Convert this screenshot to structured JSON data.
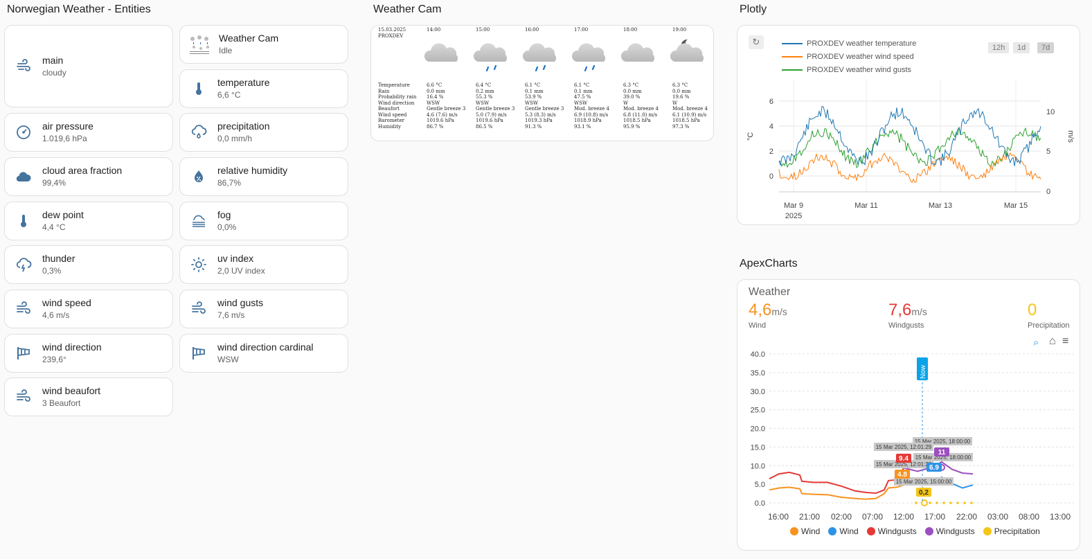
{
  "sections": {
    "entities_title": "Norwegian Weather - Entities",
    "weathercam_title": "Weather Cam",
    "plotly_title": "Plotly",
    "apex_title": "ApexCharts"
  },
  "entities_left": [
    {
      "name": "main",
      "state": "cloudy",
      "icon": "weather-cloudy-icon"
    },
    {
      "name": "air pressure",
      "state": "1.019,6 hPa",
      "icon": "gauge-icon"
    },
    {
      "name": "cloud area fraction",
      "state": "99,4%",
      "icon": "cloud-icon"
    },
    {
      "name": "dew point",
      "state": "4,4 °C",
      "icon": "thermometer-icon"
    },
    {
      "name": "thunder",
      "state": "0,3%",
      "icon": "lightning-cloud-icon"
    },
    {
      "name": "wind speed",
      "state": "4,6 m/s",
      "icon": "wind-icon"
    },
    {
      "name": "wind direction",
      "state": "239,6°",
      "icon": "windsock-icon"
    },
    {
      "name": "wind beaufort",
      "state": "3 Beaufort",
      "icon": "wind-icon"
    }
  ],
  "entities_right": [
    {
      "name": "Weather Cam",
      "state": "Idle",
      "icon": "weather-cam-thumbnail"
    },
    {
      "name": "temperature",
      "state": "6,6 °C",
      "icon": "thermometer-icon"
    },
    {
      "name": "precipitation",
      "state": "0,0 mm/h",
      "icon": "rain-cloud-icon"
    },
    {
      "name": "relative humidity",
      "state": "86,7%",
      "icon": "water-percent-icon"
    },
    {
      "name": "fog",
      "state": "0,0%",
      "icon": "fog-icon"
    },
    {
      "name": "uv index",
      "state": "2,0 UV index",
      "icon": "sun-icon"
    },
    {
      "name": "wind gusts",
      "state": "7,6 m/s",
      "icon": "wind-icon"
    },
    {
      "name": "wind direction cardinal",
      "state": "WSW",
      "icon": "windsock-icon"
    }
  ],
  "weathercam": {
    "date": "15.03.2025",
    "station": "PROXDEV",
    "row_labels": [
      "Temperature",
      "Rain",
      "Probability rain",
      "Wind direction",
      "Beaufort",
      "Wind speed",
      "Barometer",
      "Humidity"
    ],
    "columns": [
      {
        "time": "14:00",
        "rain": false,
        "night": false,
        "values": [
          "6.6 °C",
          "0.0 mm",
          "16.4 %",
          "WSW",
          "Gentle breeze 3",
          "4.6 (7.6) m/s",
          "1019.6 hPa",
          "86.7 %"
        ]
      },
      {
        "time": "15:00",
        "rain": true,
        "night": false,
        "values": [
          "6.4 °C",
          "0.2 mm",
          "55.3 %",
          "WSW",
          "Gentle breeze 3",
          "5.0 (7.9) m/s",
          "1019.6 hPa",
          "86.5 %"
        ]
      },
      {
        "time": "16:00",
        "rain": true,
        "night": false,
        "values": [
          "6.1 °C",
          "0.1 mm",
          "53.9 %",
          "WSW",
          "Gentle breeze 3",
          "5.3 (8.3) m/s",
          "1019.3 hPa",
          "91.3 %"
        ]
      },
      {
        "time": "17:00",
        "rain": true,
        "night": false,
        "values": [
          "6.1 °C",
          "0.1 mm",
          "47.5 %",
          "WSW",
          "Mod. breeze 4",
          "6.9 (10.8) m/s",
          "1018.9 hPa",
          "93.1 %"
        ]
      },
      {
        "time": "18:00",
        "rain": false,
        "night": false,
        "values": [
          "6.3 °C",
          "0.0 mm",
          "39.0 %",
          "W",
          "Mod. breeze 4",
          "6.8 (11.0) m/s",
          "1018.5 hPa",
          "95.9 %"
        ]
      },
      {
        "time": "19:00",
        "rain": false,
        "night": true,
        "values": [
          "6.3 °C",
          "0.0 mm",
          "19.6 %",
          "W",
          "Mod. breeze 4",
          "6.1 (10.9) m/s",
          "1018.5 hPa",
          "97.3 %"
        ]
      }
    ]
  },
  "plotly": {
    "legend": [
      {
        "label": "PROXDEV weather temperature",
        "color": "#1f77b4"
      },
      {
        "label": "PROXDEV weather wind speed",
        "color": "#ff7f0e"
      },
      {
        "label": "PROXDEV weather wind gusts",
        "color": "#2ca02c"
      }
    ],
    "buttons": [
      "12h",
      "1d",
      "7d"
    ],
    "reset_icon": "↻",
    "y_left_label": "°C",
    "y_right_label": "m/s",
    "y_left_ticks": [
      "6",
      "4",
      "2",
      "0"
    ],
    "y_right_ticks": [
      "10",
      "5",
      "0"
    ],
    "x_ticks": [
      "Mar 9",
      "Mar 11",
      "Mar 13",
      "Mar 15"
    ],
    "x_year": "2025"
  },
  "apex": {
    "title": "Weather",
    "stats": [
      {
        "value": "4,6",
        "unit": "m/s",
        "label": "Wind",
        "color": "#f7931e"
      },
      {
        "value": "7,6",
        "unit": "m/s",
        "label": "Windgusts",
        "color": "#e53935"
      },
      {
        "value": "0",
        "unit": "",
        "label": "Precipitation",
        "color": "#f5c518"
      }
    ],
    "y_ticks": [
      "40.0",
      "35.0",
      "30.0",
      "25.0",
      "20.0",
      "15.0",
      "10.0",
      "5.0",
      "0.0"
    ],
    "x_ticks": [
      "16:00",
      "21:00",
      "02:00",
      "07:00",
      "12:00",
      "17:00",
      "22:00",
      "03:00",
      "08:00",
      "13:00"
    ],
    "now_label": "Now",
    "tooltips": {
      "gust_max": "15 Mar 2025, 18:00:00",
      "gust_now": "15 Mar 2025, 12:01:29",
      "wind_max": "15 Mar 2025, 18:00:00",
      "wind_now": "15 Mar 2025, 12:01:29",
      "precip": "15 Mar 2025, 15:00:00"
    },
    "point_labels": {
      "gust_max": "11",
      "gust_now": "9.4",
      "wind_max": "6.9",
      "wind_now": "4.8",
      "precip": "0,2"
    },
    "legend": [
      {
        "label": "Wind",
        "color": "#f7931e"
      },
      {
        "label": "Wind",
        "color": "#2e93e6"
      },
      {
        "label": "Windgusts",
        "color": "#e53935"
      },
      {
        "label": "Windgusts",
        "color": "#9c4fc0"
      },
      {
        "label": "Precipitation",
        "color": "#f5c518"
      }
    ]
  }
}
